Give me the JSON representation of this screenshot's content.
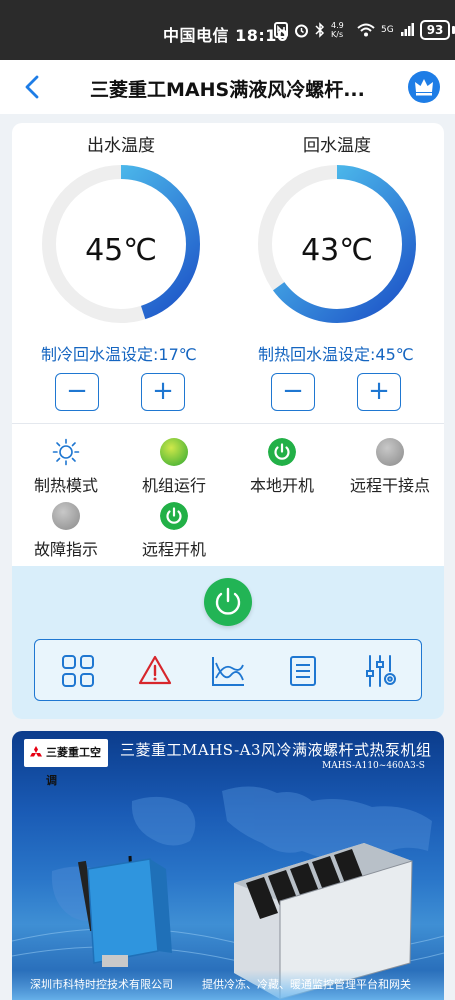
{
  "status_bar": {
    "carrier_time": "中国电信 18:10",
    "network_speed": "4.9 K/s",
    "signal": "5G",
    "battery": "93"
  },
  "nav": {
    "title": "三菱重工MAHS满液风冷螺杆..."
  },
  "gauges": [
    {
      "label": "出水温度",
      "value": "45℃",
      "setpoint": "制冷回水温设定:17℃",
      "fill_fraction": 0.45,
      "fill_direction": "clockwise"
    },
    {
      "label": "回水温度",
      "value": "43℃",
      "setpoint": "制热回水温设定:45℃",
      "fill_fraction": 0.65,
      "fill_direction": "clockwise"
    }
  ],
  "buttons": {
    "minus": "−",
    "plus": "+"
  },
  "indicators": [
    {
      "label": "制热模式",
      "icon": "sun-icon"
    },
    {
      "label": "机组运行",
      "icon": "green-dot-icon"
    },
    {
      "label": "本地开机",
      "icon": "power-on-icon"
    },
    {
      "label": "远程干接点",
      "icon": "grey-dot-icon"
    },
    {
      "label": "故障指示",
      "icon": "grey-dot-icon"
    },
    {
      "label": "远程开机",
      "icon": "power-on-icon"
    }
  ],
  "toolbar": {
    "items": [
      "grid-icon",
      "warning-icon",
      "chart-icon",
      "list-icon",
      "settings-sliders-icon"
    ]
  },
  "colors": {
    "accent": "#1f77d1",
    "gauge_track": "#eeeeee",
    "gauge_start": "#1b4fc6",
    "gauge_end": "#5ad6f5",
    "power_green": "#22b455",
    "setpoint_text": "#1565c0"
  },
  "banner": {
    "logo_text": "三菱重工空调",
    "title": "三菱重工MAHS-A3风冷满液螺杆式热泵机组",
    "model": "MAHS-A110~460A3-S",
    "company": "深圳市科特时控技术有限公司",
    "service": "提供冷冻、冷藏、暖通监控管理平台和网关"
  }
}
